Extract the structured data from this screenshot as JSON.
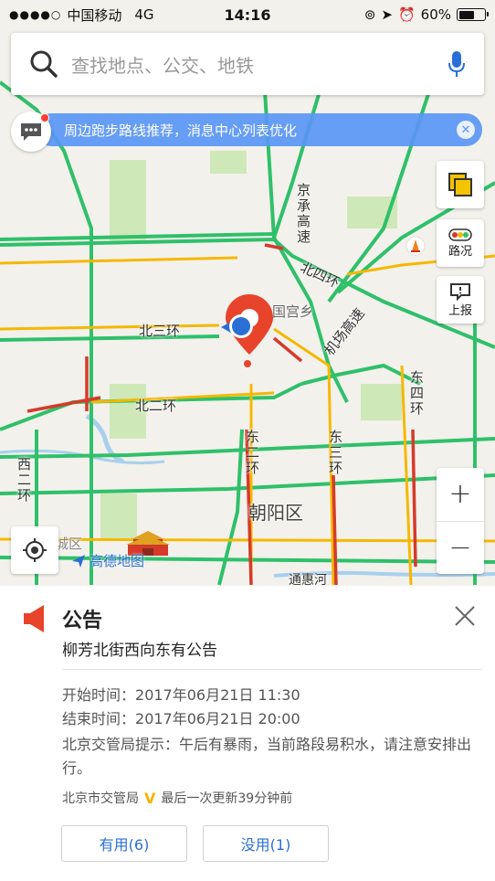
{
  "status_bar": {
    "carrier": "中国移动",
    "network": "4G",
    "time": "14:16",
    "battery": "60%",
    "battery_level": 0.6
  },
  "search": {
    "placeholder": "查找地点、公交、地铁"
  },
  "notice": {
    "text": "周边跑步路线推荐，消息中心列表优化"
  },
  "tools": {
    "layers_icon": "layers-icon",
    "traffic_label": "路况",
    "report_label": "上报"
  },
  "map": {
    "labels": {
      "jingcheng": "京承高速",
      "beisihuan": "北四环",
      "jiangongxiang": "国宫乡",
      "jichang": "机场高速",
      "beisanhuan": "北三环",
      "dongsihuan": "东四环",
      "beierhuan": "北二环",
      "dongerhuan": "东二环",
      "dongsanhuan": "东三环",
      "xierhuan": "西二环",
      "district": "朝阳区",
      "tonghuihe": "通惠河",
      "xicheng": "城区"
    },
    "logo_text": "高德地图",
    "colors": {
      "smooth": "#2fc06a",
      "slow": "#f5b800",
      "jam": "#d63a2a",
      "marker": "#e8432b",
      "location": "#2a6fd6"
    }
  },
  "zoom": {
    "in": "+",
    "out": "−"
  },
  "panel": {
    "title": "公告",
    "subtitle": "柳芳北街西向东有公告",
    "start_label": "开始时间：",
    "start_value": "2017年06月21日 11:30",
    "end_label": "结束时间：",
    "end_value": "2017年06月21日 20:00",
    "tip": "北京交管局提示：午后有暴雨，当前路段易积水，请注意安排出行。",
    "source": "北京市交管局",
    "updated": "最后一次更新39分钟前",
    "useful_button": "有用(6)",
    "useless_button": "没用(1)"
  }
}
